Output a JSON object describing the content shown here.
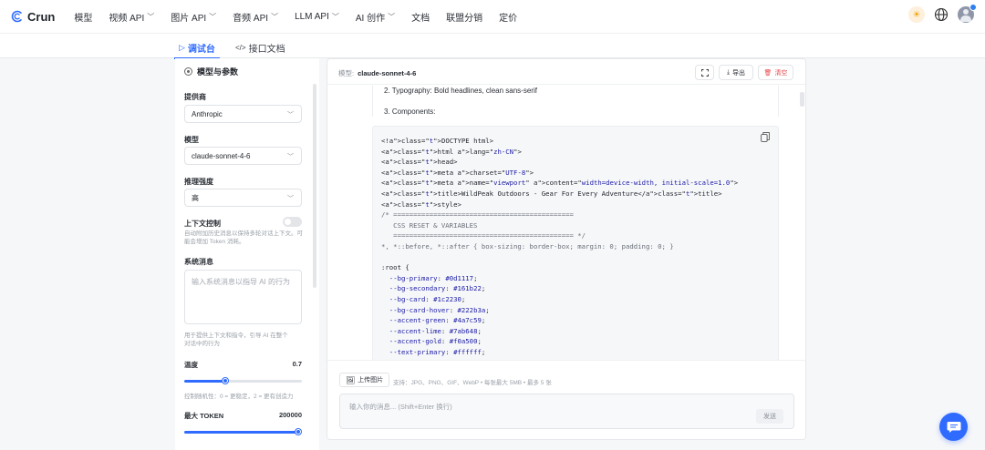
{
  "nav": {
    "brand": "Crun",
    "items": [
      {
        "label": "模型",
        "has_dropdown": false
      },
      {
        "label": "视频 API",
        "has_dropdown": true
      },
      {
        "label": "图片 API",
        "has_dropdown": true
      },
      {
        "label": "音频 API",
        "has_dropdown": true
      },
      {
        "label": "LLM API",
        "has_dropdown": true
      },
      {
        "label": "AI 创作",
        "has_dropdown": true
      },
      {
        "label": "文档",
        "has_dropdown": false
      },
      {
        "label": "联盟分销",
        "has_dropdown": false
      },
      {
        "label": "定价",
        "has_dropdown": false
      }
    ],
    "icons": [
      "sun-icon",
      "globe-icon",
      "avatar"
    ]
  },
  "tabs": {
    "debug": "调试台",
    "docs": "接口文档"
  },
  "left": {
    "section_title": "模型与参数",
    "provider_label": "提供商",
    "provider_value": "Anthropic",
    "model_label": "模型",
    "model_value": "claude-sonnet-4-6",
    "reasoning_label": "推理强度",
    "reasoning_value": "高",
    "context_label": "上下文控制",
    "context_hint": "自动附加历史消息以保持多轮对话上下文。可能会增加 Token 消耗。",
    "system_label": "系统消息",
    "system_placeholder": "输入系统消息以指导 AI 的行为",
    "system_hint": "用于提供上下文和指令，引导 AI 在整个对话中的行为",
    "temperature_label": "温度",
    "temperature_value": "0.7",
    "temperature_fraction": 0.35,
    "temperature_hint": "控制随机性：0 = 更稳定，2 = 更有创造力",
    "max_token_label": "最大 TOKEN",
    "max_token_value": "200000",
    "max_token_fraction": 0.97
  },
  "main": {
    "model_prefix": "模型:",
    "model_name": "claude-sonnet-4-6",
    "export_label": "导出",
    "clear_label": "清空",
    "prev_lines": [
      "2. Typography: Bold headlines, clean sans-serif",
      "3. Components:"
    ],
    "code_lines": [
      "<!DOCTYPE html>",
      "<html lang=\"zh-CN\">",
      "<head>",
      "<meta charset=\"UTF-8\">",
      "<meta name=\"viewport\" content=\"width=device-width, initial-scale=1.0\">",
      "<title>WildPeak Outdoors - Gear For Every Adventure</title>",
      "<style>",
      "/* =============================================",
      "   CSS RESET & VARIABLES",
      "   ============================================= */",
      "*, *::before, *::after { box-sizing: border-box; margin: 0; padding: 0; }",
      "",
      ":root {",
      "  --bg-primary: #0d1117;",
      "  --bg-secondary: #161b22;",
      "  --bg-card: #1c2230;",
      "  --bg-card-hover: #222b3a;",
      "  --accent-green: #4a7c59;",
      "  --accent-lime: #7ab648;",
      "  --accent-gold: #f0a500;",
      "  --text-primary: #ffffff;"
    ],
    "upload_label": "上传图片",
    "upload_hint": "支持：JPG、PNG、GIF、WebP • 每张最大 5MB • 最多 5 张",
    "message_placeholder": "输入你的消息... (Shift+Enter 换行)",
    "send_label": "发送"
  },
  "colors": {
    "accent": "#2f6bff",
    "danger": "#e5484d"
  }
}
